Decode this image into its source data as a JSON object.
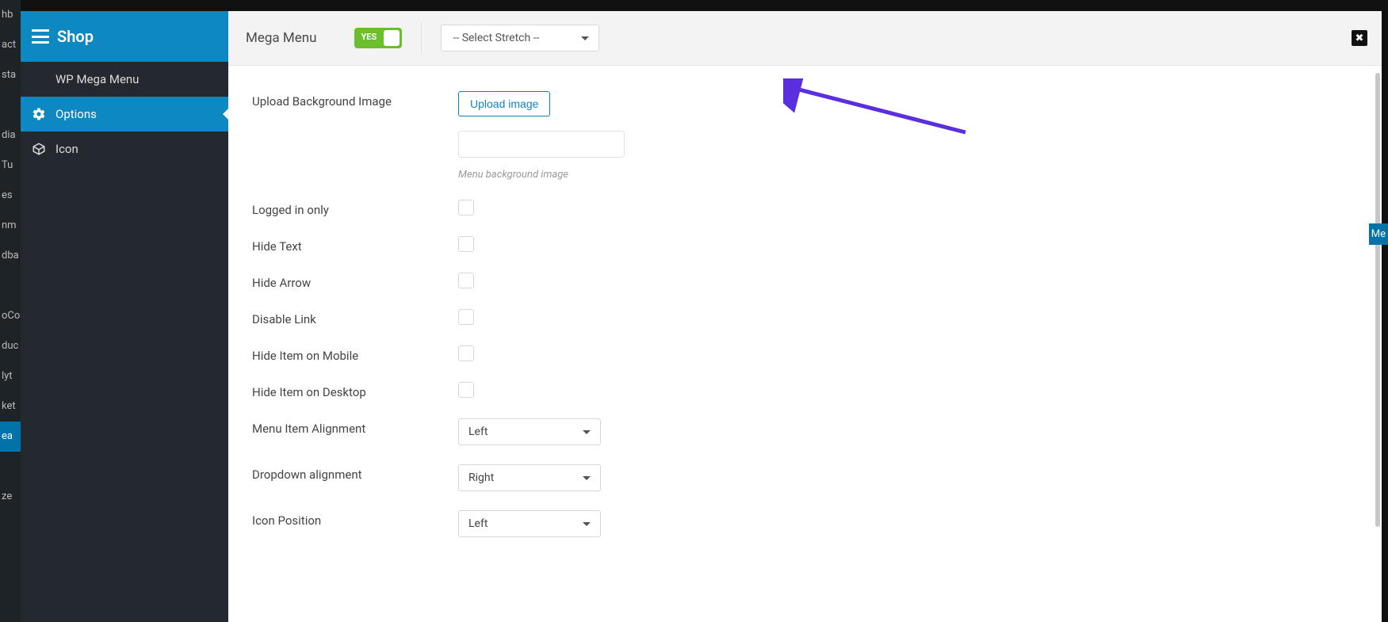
{
  "wp_admin": {
    "items": [
      "hb",
      "act",
      "sta",
      "",
      "dia",
      "Tu",
      "es",
      "nm",
      "dba",
      "",
      "oCo",
      "duc",
      "lyt",
      "ket",
      "ea",
      "",
      "ze"
    ],
    "highlighted_index": 14,
    "right_label": "Me"
  },
  "sidebar": {
    "brand": "Shop",
    "items": [
      {
        "label": "WP Mega Menu",
        "icon": "grid-icon"
      },
      {
        "label": "Options",
        "icon": "gear-icon"
      },
      {
        "label": "Icon",
        "icon": "box-icon"
      }
    ],
    "active_index": 1
  },
  "topbar": {
    "title": "Mega Menu",
    "toggle_state": "YES",
    "stretch_placeholder": "-- Select Stretch --"
  },
  "form": {
    "upload_bg": {
      "label": "Upload Background Image",
      "button": "Upload image",
      "hint": "Menu background image"
    },
    "checks": [
      {
        "label": "Logged in only"
      },
      {
        "label": "Hide Text"
      },
      {
        "label": "Hide Arrow"
      },
      {
        "label": "Disable Link"
      },
      {
        "label": "Hide Item on Mobile"
      },
      {
        "label": "Hide Item on Desktop"
      }
    ],
    "selects": [
      {
        "label": "Menu Item Alignment",
        "value": "Left"
      },
      {
        "label": "Dropdown alignment",
        "value": "Right"
      },
      {
        "label": "Icon Position",
        "value": "Left"
      }
    ]
  },
  "colors": {
    "accent": "#0d88c1",
    "toggle_green": "#6bbf2e",
    "annotation": "#5b2fe0"
  }
}
